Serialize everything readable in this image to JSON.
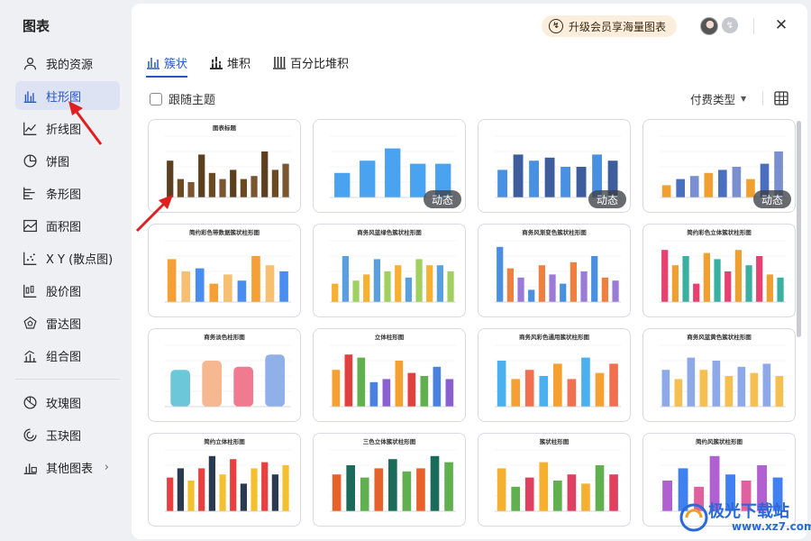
{
  "sidebar": {
    "title": "图表",
    "items": [
      {
        "label": "我的资源",
        "icon": "user-icon"
      },
      {
        "label": "柱形图",
        "icon": "bar-chart-icon"
      },
      {
        "label": "折线图",
        "icon": "line-chart-icon"
      },
      {
        "label": "饼图",
        "icon": "pie-chart-icon"
      },
      {
        "label": "条形图",
        "icon": "horizontal-bar-icon"
      },
      {
        "label": "面积图",
        "icon": "area-chart-icon"
      },
      {
        "label": "X Y (散点图)",
        "icon": "scatter-icon"
      },
      {
        "label": "股价图",
        "icon": "stock-chart-icon"
      },
      {
        "label": "雷达图",
        "icon": "radar-icon"
      },
      {
        "label": "组合图",
        "icon": "combo-chart-icon"
      },
      {
        "label": "玫瑰图",
        "icon": "rose-chart-icon"
      },
      {
        "label": "玉玦图",
        "icon": "ring-chart-icon"
      },
      {
        "label": "其他图表",
        "icon": "other-chart-icon"
      }
    ],
    "active_index": 1
  },
  "header": {
    "upgrade_label": "升级会员享海量图表",
    "close_glyph": "✕"
  },
  "tabs": [
    {
      "label": "簇状",
      "active": true
    },
    {
      "label": "堆积",
      "active": false
    },
    {
      "label": "百分比堆积",
      "active": false
    }
  ],
  "filters": {
    "follow_theme_label": "跟随主题",
    "pay_type_label": "付费类型"
  },
  "dynamic_badge": "动态",
  "cards": [
    {
      "title": "图表标题"
    },
    {
      "title": ""
    },
    {
      "title": ""
    },
    {
      "title": ""
    },
    {
      "title": "简约彩色带数据簇状柱形图"
    },
    {
      "title": "商务风蓝绿色簇状柱形图"
    },
    {
      "title": "商务风渐变色簇状柱形图"
    },
    {
      "title": "简约彩色立体簇状柱形图"
    },
    {
      "title": "商务淡色柱形图"
    },
    {
      "title": "立体柱形图"
    },
    {
      "title": "商务风彩色通用簇状柱形图"
    },
    {
      "title": "商务风蓝黄色簇状柱形图"
    },
    {
      "title": "简约立体柱形图"
    },
    {
      "title": "三色立体簇状柱形图"
    },
    {
      "title": "簇状柱形图"
    },
    {
      "title": "简约风簇状柱形图"
    }
  ],
  "watermark": {
    "line1": "极光下载站",
    "line2": "www.xz7.com"
  },
  "colors": {
    "accent": "#2856c9",
    "active_bg": "#dde3f3",
    "upgrade_bg": "#fbeedd",
    "arrow": "#e02020"
  }
}
